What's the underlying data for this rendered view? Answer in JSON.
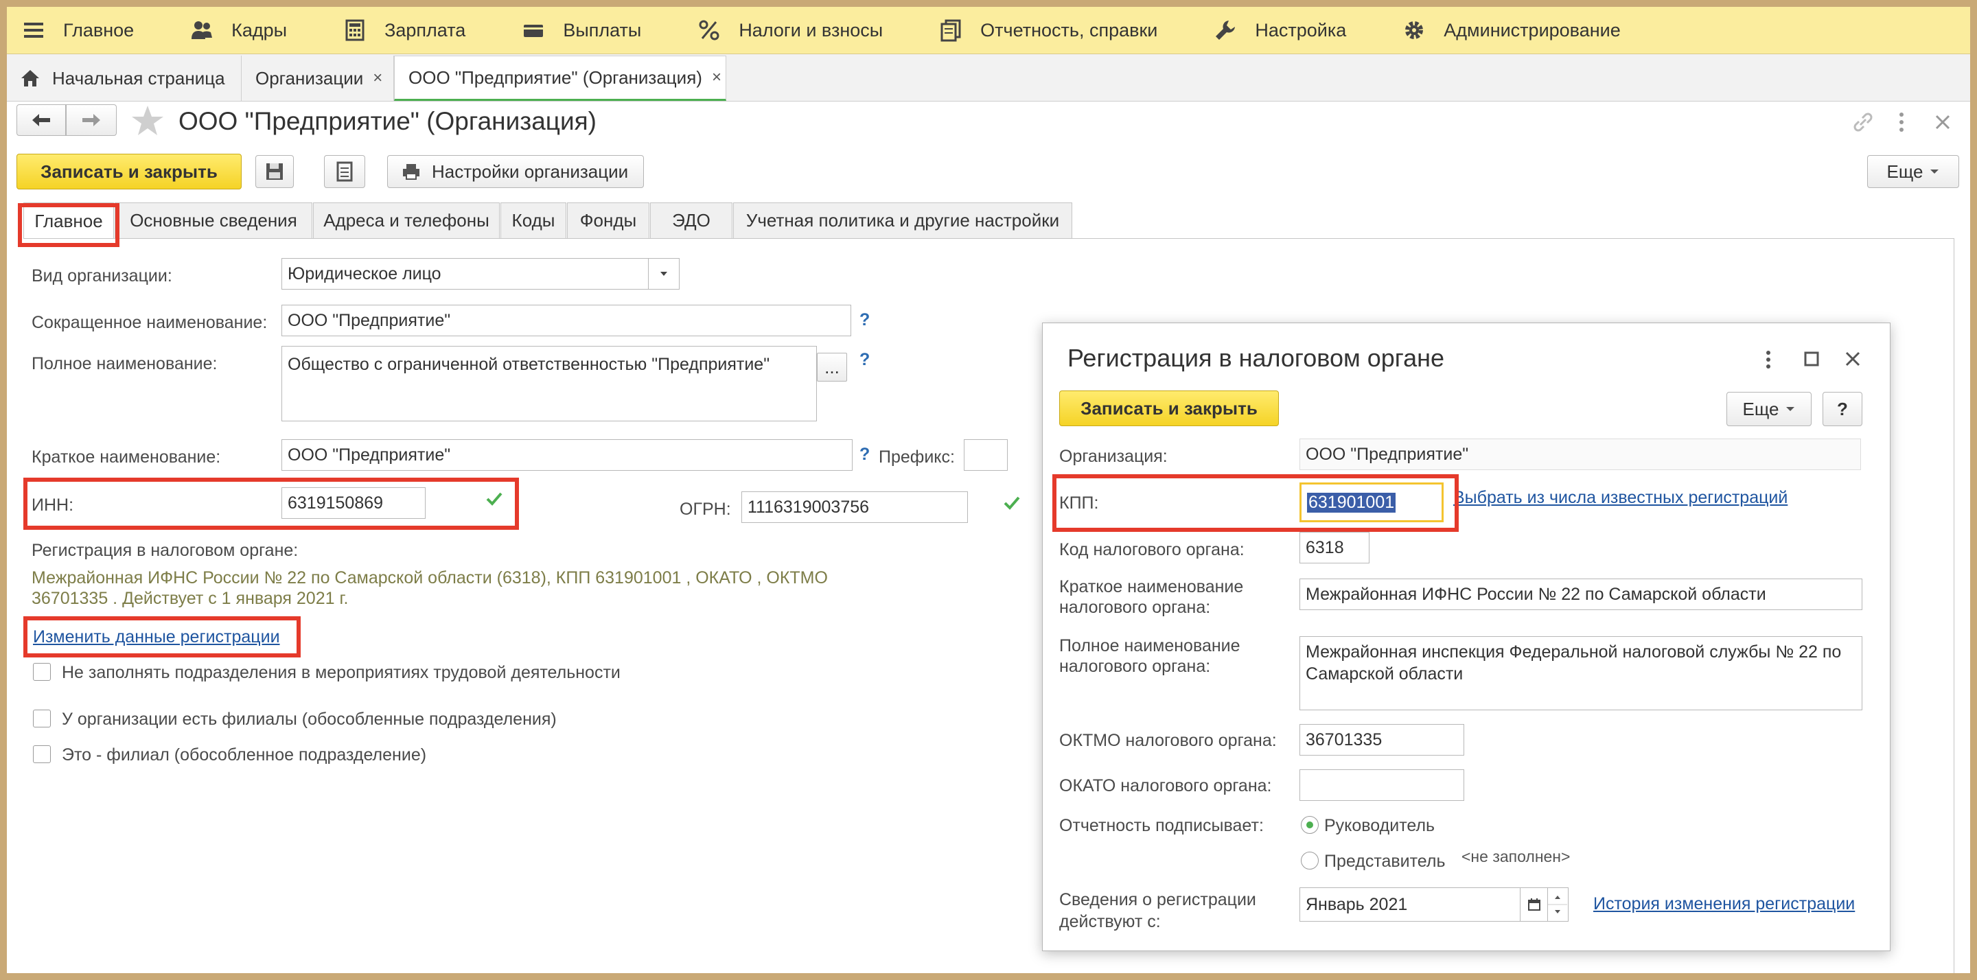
{
  "menu": [
    {
      "label": "Главное",
      "icon": "hamburger-icon"
    },
    {
      "label": "Кадры",
      "icon": "people-icon"
    },
    {
      "label": "Зарплата",
      "icon": "calculator-icon"
    },
    {
      "label": "Выплаты",
      "icon": "wallet-icon"
    },
    {
      "label": "Налоги и взносы",
      "icon": "percent-icon"
    },
    {
      "label": "Отчетность, справки",
      "icon": "documents-icon"
    },
    {
      "label": "Настройка",
      "icon": "wrench-icon"
    },
    {
      "label": "Администрирование",
      "icon": "gear-icon"
    }
  ],
  "window_tabs": [
    {
      "label": "Начальная страница",
      "icon": "home-icon"
    },
    {
      "label": "Организации",
      "close": "×"
    },
    {
      "label": "ООО \"Предприятие\" (Организация)",
      "close": "×"
    }
  ],
  "form": {
    "title": "ООО \"Предприятие\" (Организация)",
    "save_close": "Записать и закрыть",
    "settings": "Настройки организации",
    "more": "Еще",
    "tabs": [
      "Главное",
      "Основные сведения",
      "Адреса и телефоны",
      "Коды",
      "Фонды",
      "ЭДО",
      "Учетная политика и другие настройки"
    ],
    "fields": {
      "org_kind_label": "Вид организации:",
      "org_kind_value": "Юридическое лицо",
      "short_name_label": "Сокращенное наименование:",
      "short_name_value": "ООО \"Предприятие\"",
      "full_name_label": "Полное наименование:",
      "full_name_value": "Общество с ограниченной ответственностью \"Предприятие\"",
      "brief_name_label": "Краткое наименование:",
      "brief_name_value": "ООО \"Предприятие\"",
      "prefix_label": "Префикс:",
      "inn_label": "ИНН:",
      "inn_value": "6319150869",
      "ogrn_label": "ОГРН:",
      "ogrn_value": "1116319003756",
      "tax_reg_label": "Регистрация в налоговом органе:",
      "tax_reg_line1": "Межрайонная ИФНС России № 22 по Самарской области (6318), КПП 631901001 , ОКАТО , ОКТМО",
      "tax_reg_line2": "36701335    . Действует с 1 января 2021 г.",
      "change_link": "Изменить данные регистрации",
      "qmark": "?",
      "ellipsis": "..."
    },
    "checkboxes": [
      "Не заполнять подразделения в мероприятиях трудовой деятельности",
      "У организации есть филиалы (обособленные подразделения)",
      "Это - филиал (обособленное подразделение)"
    ]
  },
  "dialog": {
    "title": "Регистрация в налоговом органе",
    "save_close": "Записать и закрыть",
    "more": "Еще",
    "help": "?",
    "org_label": "Организация:",
    "org_value": "ООО \"Предприятие\"",
    "kpp_label": "КПП:",
    "kpp_value": "631901001",
    "kpp_link": "Выбрать из числа известных регистраций",
    "code_label": "Код налогового органа:",
    "code_value": "6318",
    "short_label_1": "Краткое наименование",
    "short_label_2": "налогового органа:",
    "short_value": "Межрайонная ИФНС России № 22 по Самарской области",
    "full_label_1": "Полное наименование",
    "full_label_2": "налогового органа:",
    "full_value": "Межрайонная инспекция Федеральной налоговой службы № 22 по Самарской области",
    "oktmo_label": "ОКТМО налогового органа:",
    "oktmo_value": "36701335",
    "okato_label": "ОКАТО налогового органа:",
    "okato_value": "",
    "signer_label": "Отчетность подписывает:",
    "signer_head": "Руководитель",
    "signer_rep": "Представитель",
    "signer_rep_value": "<не заполнен>",
    "valid_label_1": "Сведения о регистрации",
    "valid_label_2": "действуют с:",
    "valid_value": "Январь 2021",
    "history_link": "История изменения регистрации"
  }
}
